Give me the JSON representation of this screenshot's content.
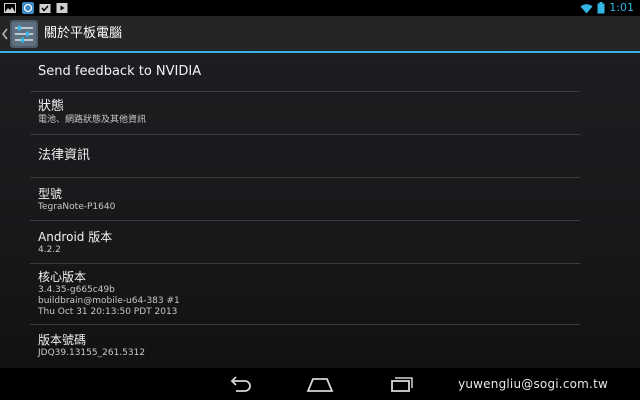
{
  "status_bar": {
    "notification_icons": [
      "gallery-icon",
      "browser-icon",
      "download-icon",
      "media-icon"
    ],
    "time": "1:01",
    "accent_color": "#33b5e5"
  },
  "action_bar": {
    "title": "關於平板電腦",
    "app_icon": "settings-sliders-icon"
  },
  "list": {
    "items": [
      {
        "title": "Send feedback to NVIDIA",
        "summary": ""
      },
      {
        "title": "狀態",
        "summary": "電池、網路狀態及其他資訊"
      },
      {
        "title": "法律資訊",
        "summary": ""
      },
      {
        "title": "型號",
        "summary": "TegraNote-P1640"
      },
      {
        "title": "Android 版本",
        "summary": "4.2.2"
      },
      {
        "title": "核心版本",
        "summary_lines": [
          "3.4.35-g665c49b",
          "buildbrain@mobile-u64-383 #1",
          "Thu Oct 31 20:13:50 PDT 2013"
        ]
      },
      {
        "title": "版本號碼",
        "summary": "JDQ39.13155_261.5312"
      }
    ]
  },
  "nav_bar": {
    "buttons": [
      "back-icon",
      "home-icon",
      "recent-apps-icon"
    ]
  },
  "watermark": "yuwengliu@sogi.com.tw"
}
